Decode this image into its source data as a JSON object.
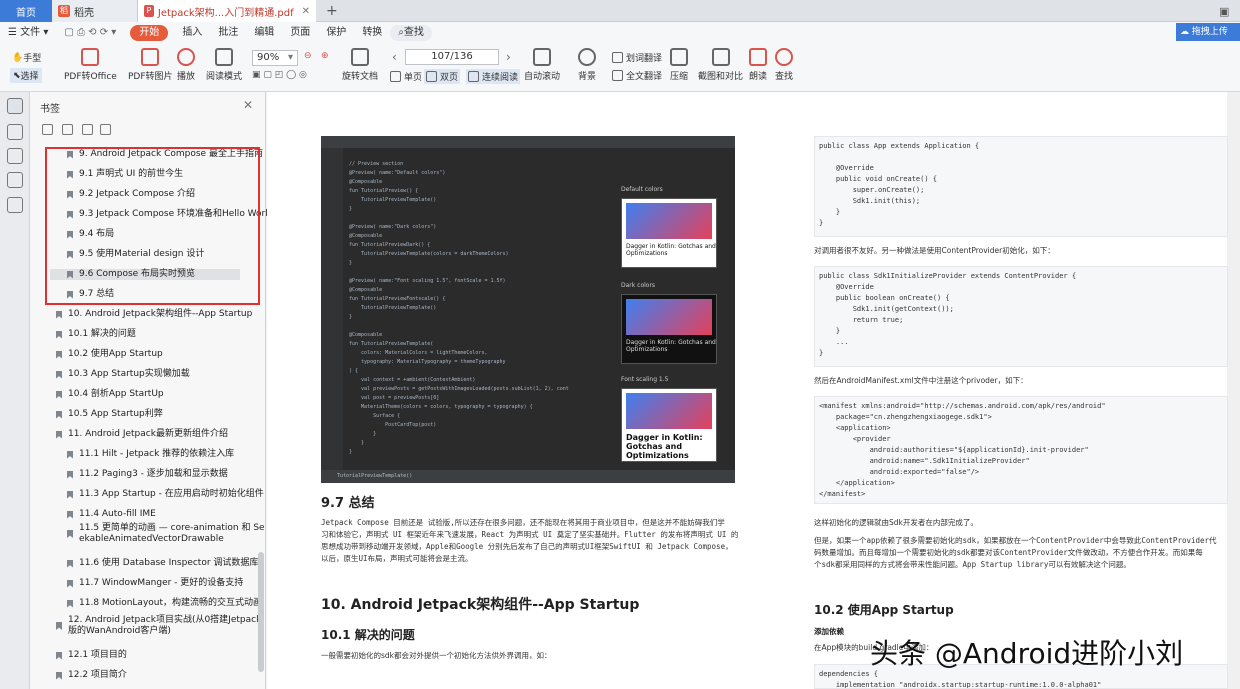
{
  "tabs": {
    "home": "首页",
    "daoke": "稻壳",
    "pdf": "Jetpack架构...入门到精通.pdf",
    "new_tab": "+"
  },
  "menu": {
    "file": "文件",
    "start": "开始",
    "insert": "插入",
    "annotate": "批注",
    "edit": "编辑",
    "page": "页面",
    "protect": "保护",
    "convert": "转换",
    "search": "查找"
  },
  "toolbar": {
    "hand": "手型",
    "select": "选择",
    "pdf_office": "PDF转Office",
    "pdf_image": "PDF转图片",
    "play": "播放",
    "read_mode": "阅读模式",
    "zoom": "90%",
    "rotate": "旋转文档",
    "single": "单页",
    "double": "双页",
    "continuous": "连续阅读",
    "page_value": "107/136",
    "auto_scroll": "自动滚动",
    "background": "背景",
    "translate_word": "划词翻译",
    "translate_full": "全文翻译",
    "compress": "压缩",
    "screenshot_compare": "截图和对比",
    "read_aloud": "朗读",
    "find": "查找",
    "cloud": "拖拽上传"
  },
  "bookmarks": {
    "title": "书签",
    "items": [
      {
        "label": "9. Android Jetpack Compose 最全上手指南"
      },
      {
        "label": "9.1 声明式 UI 的前世今生"
      },
      {
        "label": "9.2 Jetpack Compose 介绍"
      },
      {
        "label": "9.3 Jetpack Compose 环境准备和Hello World"
      },
      {
        "label": "9.4 布局"
      },
      {
        "label": "9.5 使用Material design 设计"
      },
      {
        "label": "9.6 Compose 布局实时预览"
      },
      {
        "label": "9.7 总结"
      },
      {
        "label": "10. Android Jetpack架构组件--App Startup"
      },
      {
        "label": "10.1 解决的问题"
      },
      {
        "label": "10.2 使用App Startup"
      },
      {
        "label": "10.3 App Startup实现懒加载"
      },
      {
        "label": "10.4 剖析App StartUp"
      },
      {
        "label": "10.5 App Startup利弊"
      },
      {
        "label": "11. Android Jetpack最新更新组件介绍"
      },
      {
        "label": "11.1 Hilt - Jetpack 推荐的依赖注入库"
      },
      {
        "label": "11.2 Paging3 - 逐步加载和显示数据"
      },
      {
        "label": "11.3 App Startup - 在应用启动时初始化组件"
      },
      {
        "label": "11.4 Auto-fill IME"
      },
      {
        "label": "11.5 更简单的动画 — core-animation 和 Se\nekableAnimatedVectorDrawable"
      },
      {
        "label": "11.6 使用 Database Inspector 调试数据库"
      },
      {
        "label": "11.7 WindowManger - 更好的设备支持"
      },
      {
        "label": "11.8 MotionLayout，构建流畅的交互式动画"
      },
      {
        "label": "12. Android Jetpack项目实战(从0搭建Jetpack\n版的WanAndroid客户端)"
      },
      {
        "label": "12.1 项目目的"
      },
      {
        "label": "12.2 项目简介"
      }
    ]
  },
  "page": {
    "shot_code": "// Preview section\n@Preview( name:\"Default colors\")\n@Composable\nfun TutorialPreview() {\n    TutorialPreviewTemplate()\n}\n\n@Preview( name:\"Dark colors\")\n@Composable\nfun TutorialPreviewDark() {\n    TutorialPreviewTemplate(colors = darkThemeColors)\n}\n\n@Preview( name:\"Font scaling 1.5\", fontScale = 1.5f)\n@Composable\nfun TutorialPreviewFontscale() {\n    TutorialPreviewTemplate()\n}\n\n@Composable\nfun TutorialPreviewTemplate(\n    colors: MaterialColors = lightThemeColors,\n    typography: MaterialTypography = themeTypography\n) {\n    val context = +ambient(ContextAmbient)\n    val previewPosts = getPostsWithImagesLoaded(posts.subList(1, 2), cont\n    val post = previewPosts[0]\n    MaterialTheme(colors = colors, typography = typography) {\n        Surface {\n            PostCardTop(post)\n        }\n    }\n}",
    "shot_footer": "TutorialPreviewTemplate()",
    "preview_default": "Default colors",
    "preview_dark": "Dark colors",
    "preview_font": "Font scaling 1.5",
    "card_title": "Dagger in Kotlin: Gotchas and Optimizations",
    "h_97": "9.7 总结",
    "p_97": "Jetpack Compose 目前还是 试验版,所以还存在很多问题，还不能现在将其用于商业项目中，但是这并不能妨碍我们学\n习和体验它，声明式 UI 框架近年来飞速发展，React 为声明式 UI 奠定了坚实基础并。Flutter 的发布将声明式 UI 的\n思想成功带到移动端开发领域，Apple和Google 分别先后发布了自己的声明式UI框架SwiftUI 和 Jetpack Compose，\n以后，原生UI布局，声明式可能将会是主流。",
    "h_10": "10. Android Jetpack架构组件--App Startup",
    "h_101": "10.1 解决的问题",
    "p_101": "一般需要初始化的sdk都会对外提供一个初始化方法供外界调用，如：",
    "code1": "public class App extends Application {\n\n    @Override\n    public void onCreate() {\n        super.onCreate();\n        Sdk1.init(this);\n    }\n}",
    "p_r1": "对调用者很不友好。另一种做法是使用ContentProvider初始化，如下：",
    "code2": "public class Sdk1InitializeProvider extends ContentProvider {\n    @Override\n    public boolean onCreate() {\n        Sdk1.init(getContext());\n        return true;\n    }\n    ...\n}",
    "p_r2": "然后在AndroidManifest.xml文件中注册这个privoder，如下：",
    "code3": "<manifest xmlns:android=\"http://schemas.android.com/apk/res/android\"\n    package=\"cn.zhengzhengxiaogege.sdk1\">\n    <application>\n        <provider\n            android:authorities=\"${applicationId}.init-provider\"\n            android:name=\".Sdk1InitializeProvider\"\n            android:exported=\"false\"/>\n    </application>\n</manifest>",
    "p_r3": "这样初始化的逻辑就由Sdk开发者在内部完成了。",
    "p_r4": "但是，如果一个app依赖了很多需要初始化的sdk，如果都放在一个ContentProvider中会导致此ContentProvider代\n码数量增加。而且每增加一个需要初始化的sdk都要对该ContentProvider文件做改动，不方便合作开发。而如果每\n个sdk都采用同样的方式将会带来性能问题。App Startup library可以有效解决这个问题。",
    "h_102": "10.2 使用App Startup",
    "add_dep": "添加依赖",
    "p_r5": "在App模块的build.gradle中添加：",
    "code4": "dependencies {\n    implementation \"androidx.startup:startup-runtime:1.0.0-alpha01\""
  },
  "watermark": "头条 @Android进阶小刘"
}
